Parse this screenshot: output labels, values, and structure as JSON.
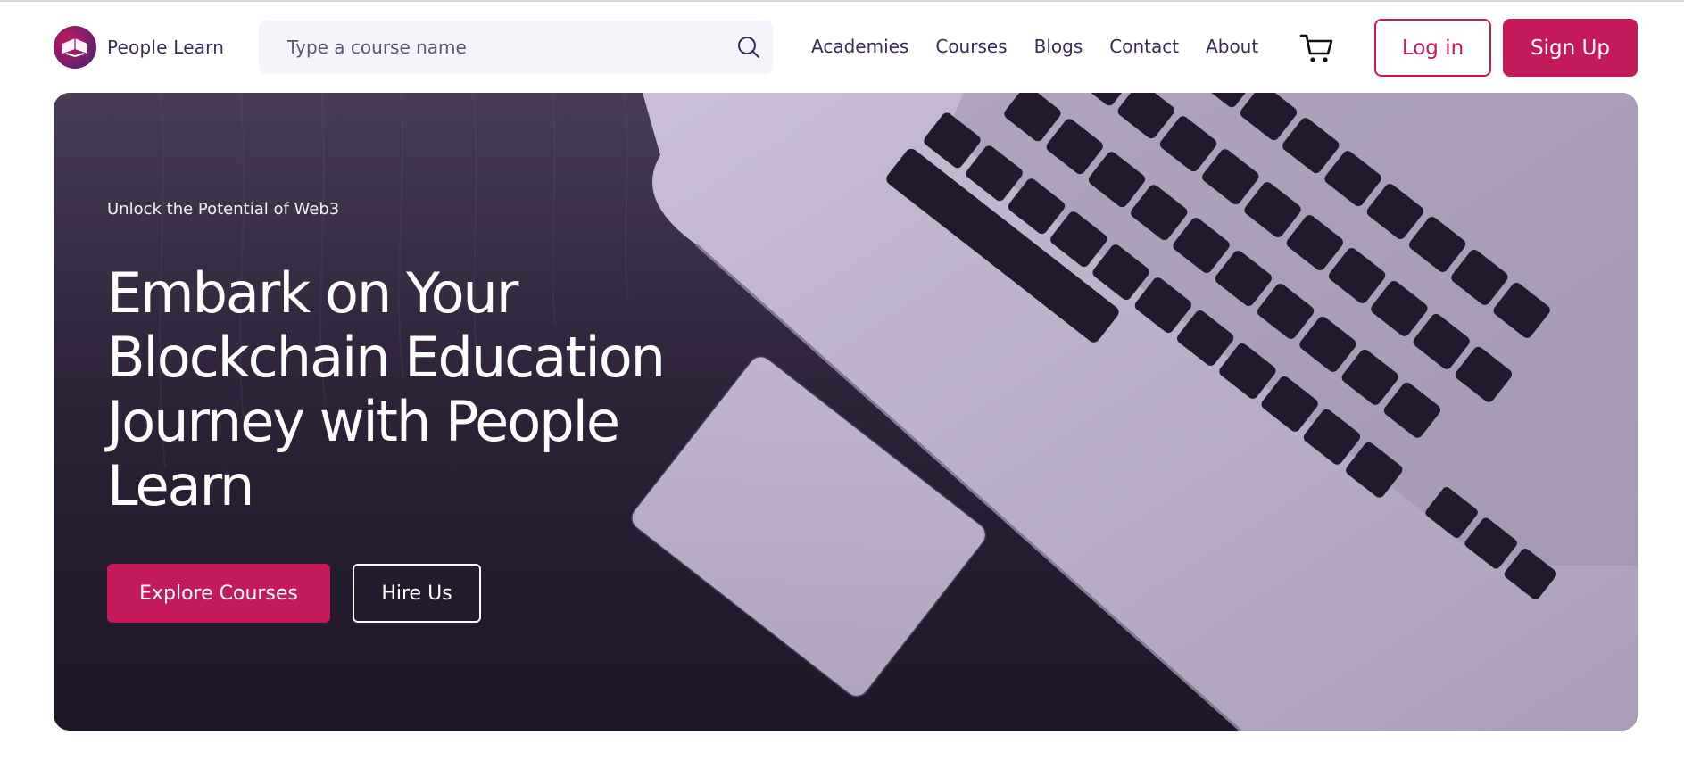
{
  "brand": {
    "name": "People Learn"
  },
  "search": {
    "placeholder": "Type a course name"
  },
  "nav": {
    "links": [
      {
        "label": "Academies"
      },
      {
        "label": "Courses"
      },
      {
        "label": "Blogs"
      },
      {
        "label": "Contact"
      },
      {
        "label": "About"
      }
    ]
  },
  "auth": {
    "login_label": "Log in",
    "signup_label": "Sign Up"
  },
  "hero": {
    "eyebrow": "Unlock the Potential of Web3",
    "title": "Embark on Your Blockchain Education Journey with People Learn",
    "primary_cta": "Explore Courses",
    "secondary_cta": "Hire Us"
  },
  "icons": {
    "search": "search-icon",
    "cart": "cart-icon",
    "logo": "book-logo-icon"
  },
  "colors": {
    "accent": "#c41a5c",
    "brand_text": "#3b2a58",
    "hero_dark": "#2a2035"
  }
}
